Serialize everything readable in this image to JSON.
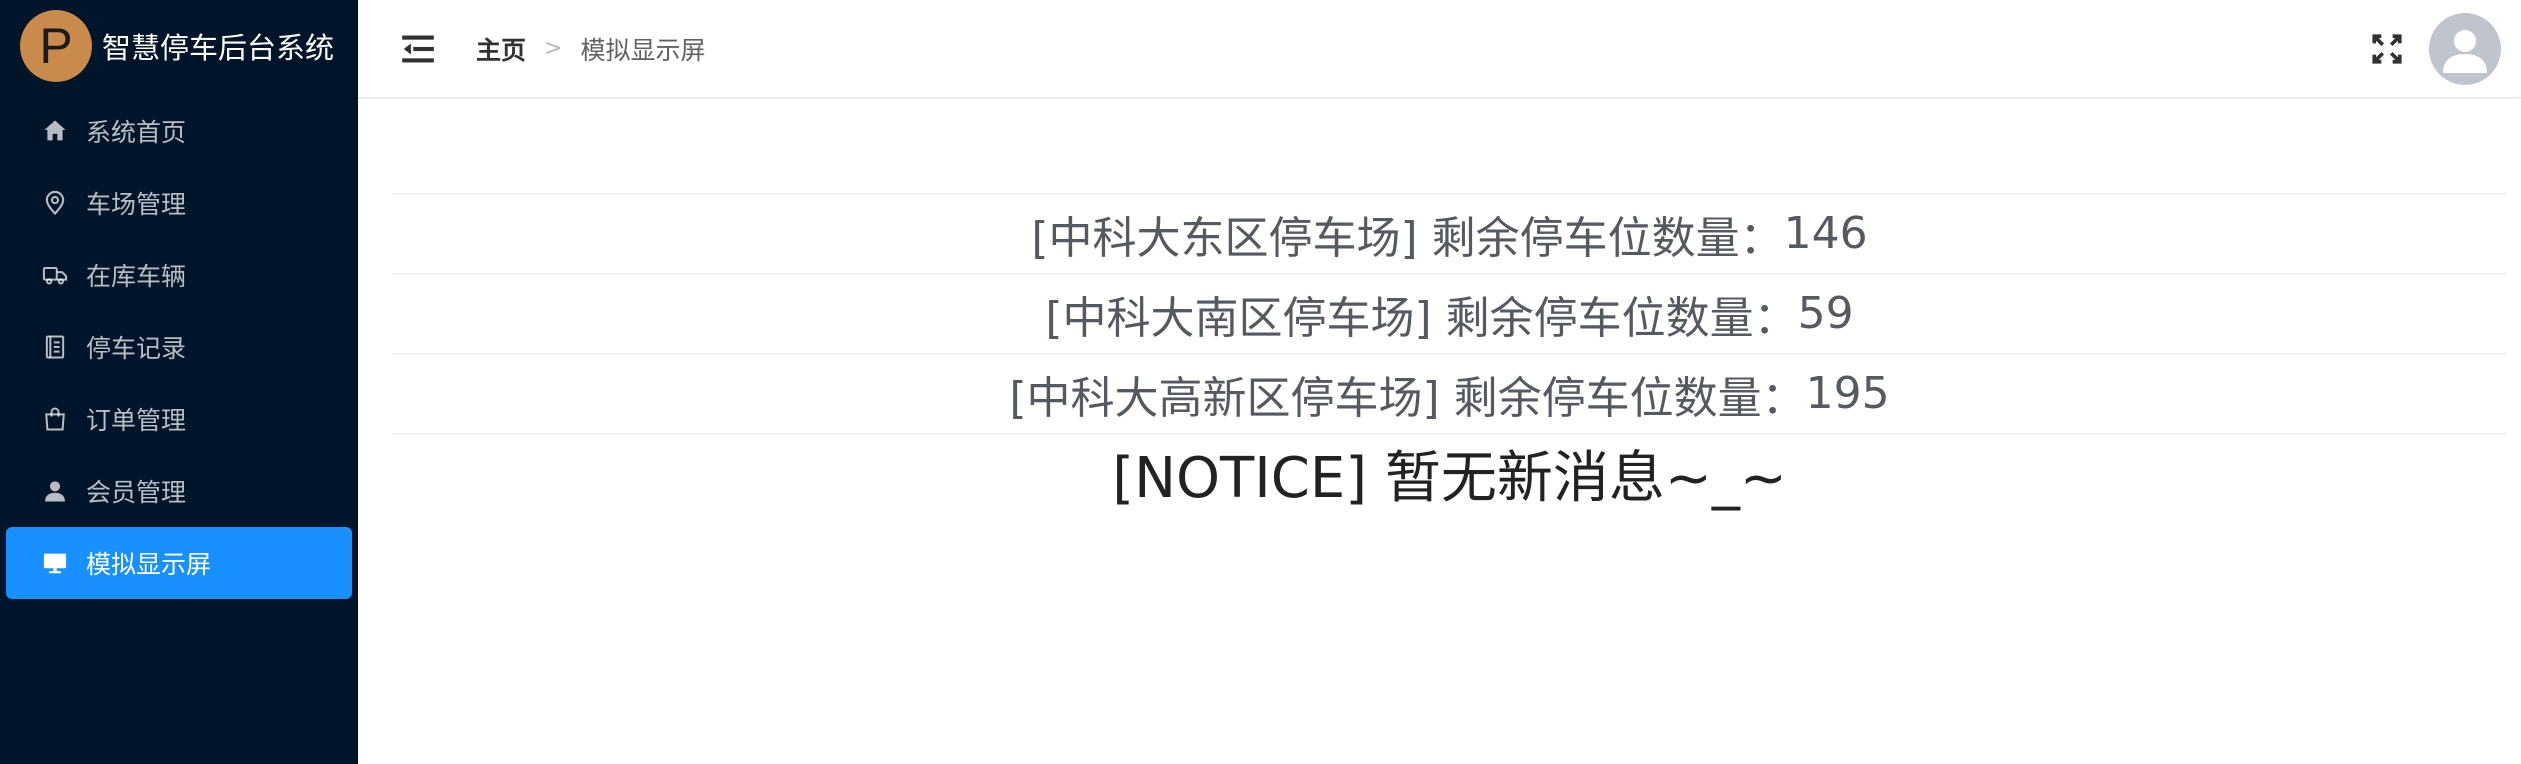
{
  "app": {
    "logo_letter": "P",
    "title": "智慧停车后台系统"
  },
  "sidebar": {
    "items": [
      {
        "label": "系统首页",
        "icon": "home-icon"
      },
      {
        "label": "车场管理",
        "icon": "location-pin-icon"
      },
      {
        "label": "在库车辆",
        "icon": "truck-icon"
      },
      {
        "label": "停车记录",
        "icon": "notebook-icon"
      },
      {
        "label": "订单管理",
        "icon": "shopping-bag-icon"
      },
      {
        "label": "会员管理",
        "icon": "user-icon"
      },
      {
        "label": "模拟显示屏",
        "icon": "monitor-icon",
        "active": true
      }
    ]
  },
  "header": {
    "breadcrumb_home": "主页",
    "breadcrumb_separator": ">",
    "breadcrumb_current": "模拟显示屏"
  },
  "display": {
    "rows": [
      {
        "lot": "[中科大东区停车场]",
        "label": "剩余停车位数量：",
        "count": "146"
      },
      {
        "lot": "[中科大南区停车场]",
        "label": "剩余停车位数量：",
        "count": "59"
      },
      {
        "lot": "[中科大高新区停车场]",
        "label": "剩余停车位数量：",
        "count": "195"
      }
    ],
    "notice": "[NOTICE] 暂无新消息~_~"
  },
  "colors": {
    "sidebar_bg": "#001529",
    "active_bg": "#1890ff",
    "logo_bg": "#c98a4b"
  }
}
